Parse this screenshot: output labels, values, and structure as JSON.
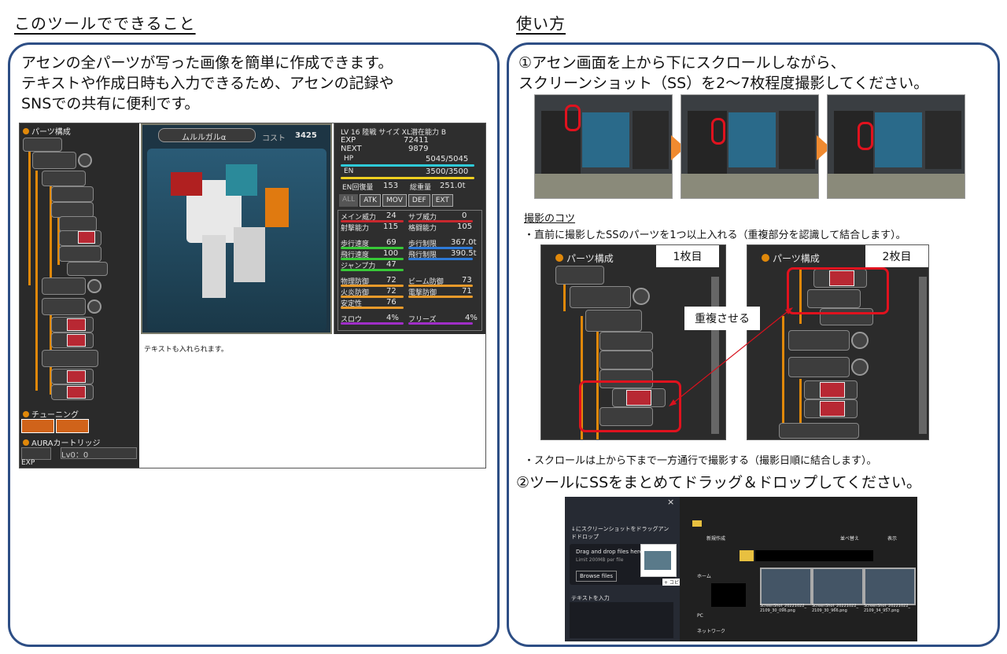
{
  "left": {
    "heading": "このツールでできること",
    "line1": "アセンの全パーツが写った画像を簡単に作成できます。",
    "line2": "テキストや作成日時も入力できるため、アセンの記録や",
    "line3": "SNSでの共有に便利です。",
    "game": {
      "parts_title": "パーツ構成",
      "robot_name": "ムルルガルα",
      "cost_label": "コスト",
      "cost_value": "3425",
      "lv_line": "LV 16  陸戦  サイズ XL潜在能力 B",
      "exp_label": "EXP",
      "exp_value": "72411",
      "next_label": "NEXT",
      "next_value": "9879",
      "hp_label": "HP",
      "hp_value": "5045/5045",
      "en_label": "EN",
      "en_value": "3500/3500",
      "en_recover_label": "EN回復量",
      "en_recover_value": "153",
      "total_weight_label": "総重量",
      "total_weight_value": "251.0t",
      "tabs": [
        "ALL",
        "ATK",
        "MOV",
        "DEF",
        "EXT"
      ],
      "stats": [
        {
          "l1": "メイン威力",
          "v1": "24",
          "l2": "サブ威力",
          "v2": "0"
        },
        {
          "l1": "射撃能力",
          "v1": "115",
          "l2": "格闘能力",
          "v2": "105"
        },
        {
          "l1": "歩行速度",
          "v1": "69",
          "l2": "歩行制限",
          "v2": "367.0t"
        },
        {
          "l1": "飛行速度",
          "v1": "100",
          "l2": "飛行制限",
          "v2": "390.5t"
        },
        {
          "l1": "ジャンプ力",
          "v1": "47",
          "l2": "",
          "v2": ""
        },
        {
          "l1": "物理防御",
          "v1": "72",
          "l2": "ビーム防御",
          "v2": "73"
        },
        {
          "l1": "火炎防御",
          "v1": "72",
          "l2": "電撃防御",
          "v2": "71"
        },
        {
          "l1": "安定性",
          "v1": "76",
          "l2": "",
          "v2": ""
        },
        {
          "l1": "スロウ",
          "v1": "4%",
          "l2": "フリーズ",
          "v2": "4%"
        }
      ],
      "tuning_label": "チューニング",
      "aura_label": "AURAカートリッジ",
      "lv_field": "Lv0：0",
      "exp_footer": "EXP",
      "note_text": "テキストも入れられます。"
    }
  },
  "right": {
    "heading": "使い方",
    "step1_line1": "①アセン画面を上から下にスクロールしながら、",
    "step1_line2": "スクリーンショット（SS）を2～7枚程度撮影してください。",
    "tips_heading": "撮影のコツ",
    "tip1": "・直前に撮影したSSのパーツを1つ以上入れる（重複部分を認識して結合します）。",
    "shot1_label": "1枚目",
    "shot2_label": "2枚目",
    "shot_title": "パーツ構成",
    "overlap_label": "重複させる",
    "tip2": "・スクロールは上から下まで一方通行で撮影する（撮影日順に結合します）。",
    "step2": "②ツールにSSをまとめてドラッグ＆ドロップしてください。",
    "tool": {
      "close_icon": "×",
      "drop_label": "↓にスクリーンショットをドラッグアンドドロップ",
      "drag_text": "Drag and drop files here",
      "limit_text": "Limit 200MB per file",
      "browse_label": "Browse files",
      "text_input_label": "テキストを入力",
      "new_label": "新規作成",
      "sort_label": "並べ替え",
      "view_label": "表示",
      "home_label": "ホーム",
      "pc_label": "PC",
      "network_label": "ネットワーク",
      "copy_badge": "+ コピー",
      "files": [
        "ScreenShot_20221022_2109_30_096.png",
        "ScreenShot_20221022_2109_30_966.png",
        "ScreenShot_20221022_2109_34_957.png"
      ]
    }
  },
  "colors": {
    "panel_border": "#2d4e85",
    "arrow": "#f08a30",
    "highlight": "#e0121e"
  }
}
